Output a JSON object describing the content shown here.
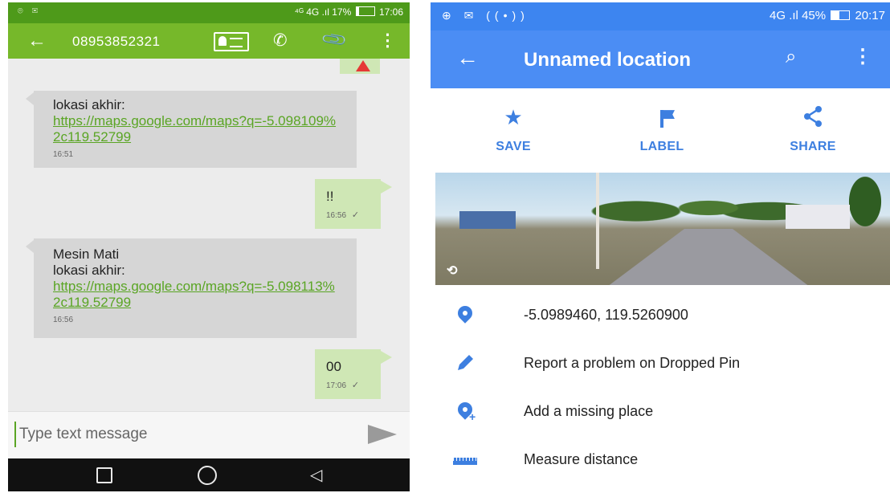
{
  "sms": {
    "status_bar": {
      "icons": "⌾ ✉",
      "network": "⁴ᴳ 4G .ıl",
      "battery": "17%",
      "time": "17:06"
    },
    "header": {
      "contact": "08953852321",
      "back_icon": "←",
      "call_icon": "✆",
      "attach_icon": "📎",
      "menu_icon": "⋮"
    },
    "messages": [
      {
        "direction": "incoming",
        "text": "lokasi akhir:",
        "link": "https://maps.google.com/maps?q=-5.098109%2c119.52799",
        "time": "16:51"
      },
      {
        "direction": "outgoing",
        "text": "!!",
        "time": "16:56",
        "status_icon": "✓"
      },
      {
        "direction": "incoming",
        "text_line1": "Mesin Mati",
        "text_line2": "lokasi akhir:",
        "link": "https://maps.google.com/maps?q=-5.098113%2c119.52799",
        "time": "16:56"
      },
      {
        "direction": "outgoing",
        "text": "00",
        "time": "17:06",
        "status_icon": "✓"
      }
    ],
    "compose": {
      "placeholder": "Type text message"
    },
    "nav": {
      "back_icon": "◁"
    }
  },
  "maps": {
    "status_bar": {
      "icons": "⊕ ✉ ((•))",
      "network": "4G .ıl",
      "battery": "45%",
      "time": "20:17"
    },
    "header": {
      "title": "Unnamed location",
      "back_icon": "←",
      "search_icon": "⌕",
      "menu_icon": "⋮"
    },
    "actions": [
      {
        "label": "SAVE",
        "icon": "★"
      },
      {
        "label": "LABEL",
        "icon": "flag-icon"
      },
      {
        "label": "SHARE",
        "icon": "share-icon"
      }
    ],
    "photo_icon": "⟲",
    "details": {
      "coordinates": "-5.0989460, 119.5260900",
      "report": "Report a problem on Dropped Pin",
      "add_place": "Add a missing place",
      "measure": "Measure distance"
    },
    "colors": {
      "accent": "#4b8df4",
      "icon_blue": "#3d7fe0"
    }
  },
  "colors": {
    "sms_app_bar": "#76b82a",
    "sms_status_bar": "#4e9a1a",
    "incoming_bubble": "#d6d6d6",
    "outgoing_bubble": "#cfe7b5",
    "link": "#5aa524"
  }
}
